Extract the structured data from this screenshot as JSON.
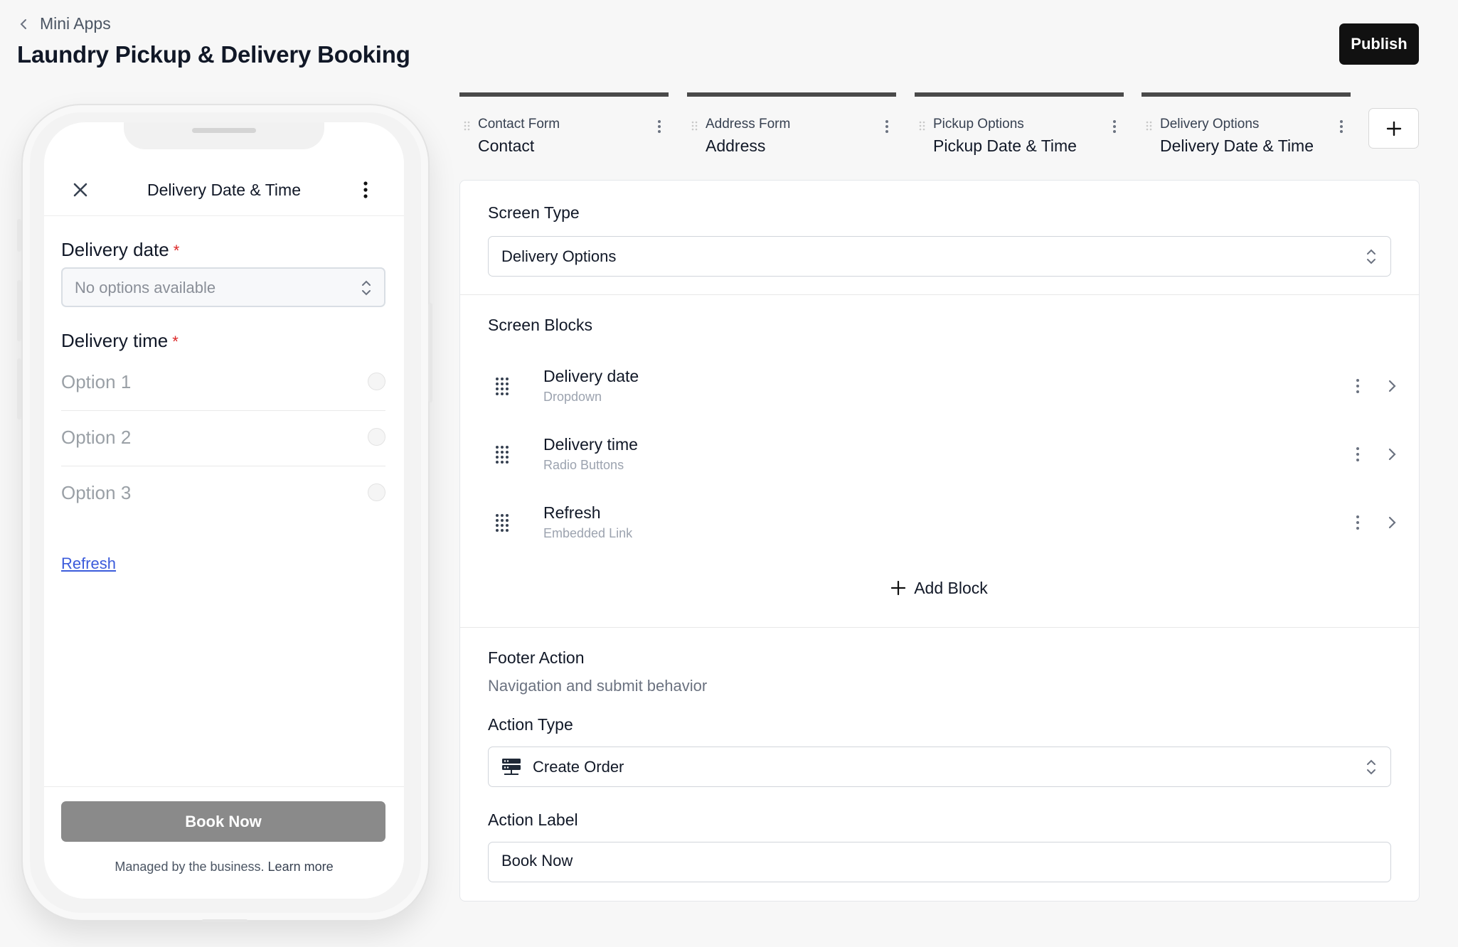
{
  "header": {
    "back_label": "Mini Apps",
    "title": "Laundry Pickup & Delivery Booking",
    "publish_label": "Publish"
  },
  "phone": {
    "title": "Delivery Date & Time",
    "date_label": "Delivery date",
    "date_placeholder": "No options available",
    "time_label": "Delivery time",
    "required_mark": "*",
    "options": [
      "Option 1",
      "Option 2",
      "Option 3"
    ],
    "link_label": "Refresh",
    "book_label": "Book Now",
    "managed_text": "Managed by the business.",
    "learn_more": "Learn more"
  },
  "tabs": [
    {
      "sub": "Contact Form",
      "main": "Contact"
    },
    {
      "sub": "Address Form",
      "main": "Address"
    },
    {
      "sub": "Pickup Options",
      "main": "Pickup Date & Time"
    },
    {
      "sub": "Delivery Options",
      "main": "Delivery Date & Time"
    }
  ],
  "editor": {
    "screen_type_label": "Screen Type",
    "screen_type_value": "Delivery Options",
    "screen_blocks_label": "Screen Blocks",
    "blocks": [
      {
        "name": "Delivery date",
        "type": "Dropdown"
      },
      {
        "name": "Delivery time",
        "type": "Radio Buttons"
      },
      {
        "name": "Refresh",
        "type": "Embedded Link"
      }
    ],
    "add_block_label": "Add Block",
    "footer_label": "Footer Action",
    "footer_sub": "Navigation and submit behavior",
    "action_type_label": "Action Type",
    "action_type_value": "Create Order",
    "action_label_label": "Action Label",
    "action_label_value": "Book Now"
  },
  "icons": {
    "back": "chevron-left-icon",
    "close": "close-icon",
    "more": "more-vertical-icon",
    "grip": "drag-grip-icon",
    "chevron_right": "chevron-right-icon",
    "plus": "plus-icon",
    "server": "server-icon",
    "select": "chevron-up-down-icon"
  },
  "colors": {
    "primary_button": "#111111",
    "disabled_button": "#8a8a8a",
    "required": "#dc2626",
    "link": "#3b5bdb"
  }
}
